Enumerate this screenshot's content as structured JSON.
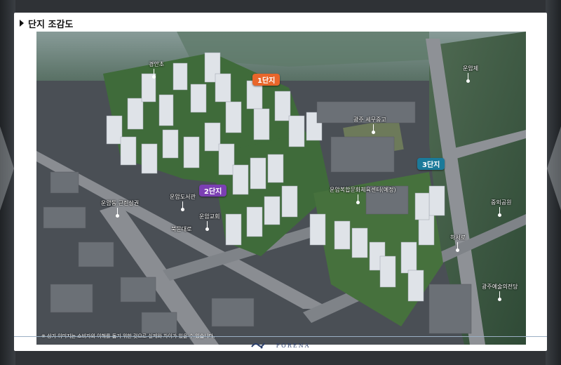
{
  "header": {
    "title": "단지 조감도"
  },
  "badges": {
    "complex1": "1단지",
    "complex2": "2단지",
    "complex3": "3단지"
  },
  "places": {
    "gyeongan_school": "경안초",
    "unamje": "운암제",
    "gwangju_sewage": "광주 세무중고",
    "unam_library": "운암도서관",
    "unamdong_market": "운암동 근린상권",
    "unam_church": "운암교회",
    "bungmun_street": "북문대로",
    "unam_sports_center": "운암복합문화체육센터(예정)",
    "jungoe_park": "중외공원",
    "hasuro": "하서로",
    "gwangju_arts_center": "광주예술의전당"
  },
  "disclaimer": "※ 상기 이미지는 소비자의 이해를 돕기 위한 것으로 실제와 차이가 있을 수 있습니다.",
  "footer": {
    "brand": "FORENA"
  },
  "colors": {
    "badge1": "#e8662b",
    "badge2": "#7b3fb3",
    "badge3": "#1b7a9a"
  }
}
